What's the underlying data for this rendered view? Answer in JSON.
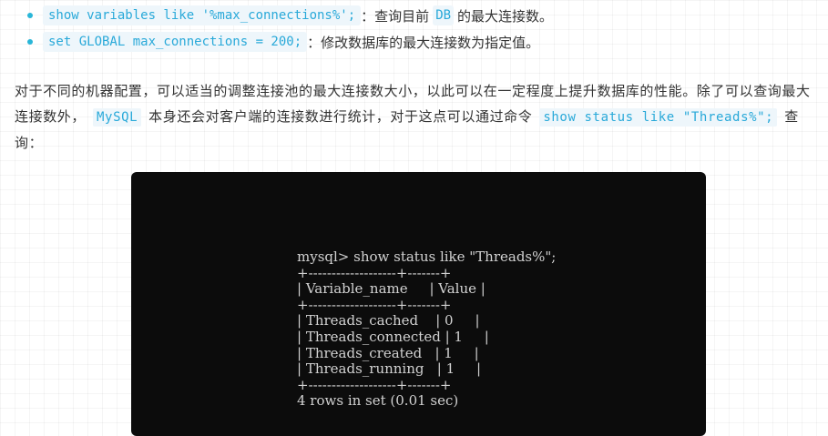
{
  "bullets": [
    {
      "code": "show variables like '%max_connections%';",
      "separator": "：",
      "text_before": "查询目前",
      "code2": "DB",
      "text_after": "的最大连接数。"
    },
    {
      "code": "set GLOBAL max_connections = 200;",
      "separator": "：",
      "text": "修改数据库的最大连接数为指定值。"
    }
  ],
  "paragraph": {
    "part1": "对于不同的机器配置，可以适当的调整连接池的最大连接数大小，以此可以在一定程度上提升数据库的性能。除了可以查询最大连接数外，",
    "code1": "MySQL",
    "part2": "本身还会对客户端的连接数进行统计，对于这点可以通过命令",
    "code2": "show status like \"Threads%\";",
    "part3": "查询："
  },
  "terminal": {
    "lines": [
      "mysql> show status like \"Threads%\";",
      "+-------------------+-------+",
      "| Variable_name     | Value |",
      "+-------------------+-------+",
      "| Threads_cached    | 0     |",
      "| Threads_connected | 1     |",
      "| Threads_created   | 1     |",
      "| Threads_running   | 1     |",
      "+-------------------+-------+",
      "4 rows in set (0.01 sec)"
    ]
  },
  "colors": {
    "code_text": "#29a9d9",
    "code_background": "#eef6fb",
    "bullet_dot": "#29b6d8",
    "terminal_background": "#0c0c0c",
    "terminal_text": "#d2d2d2"
  }
}
